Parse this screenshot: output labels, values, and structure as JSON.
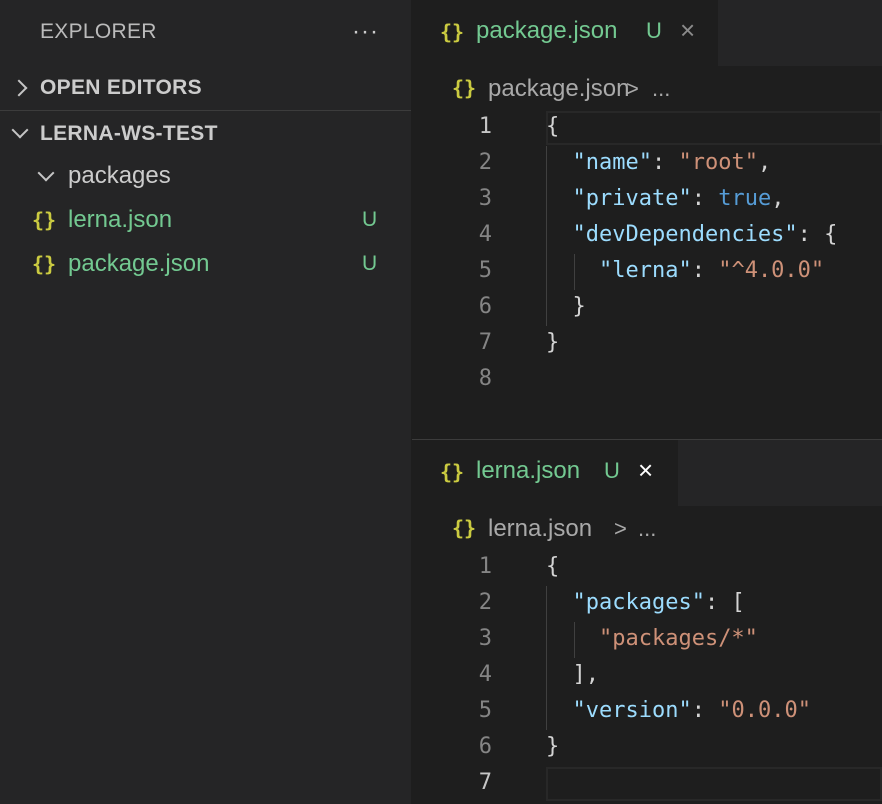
{
  "sidebar": {
    "title": "EXPLORER",
    "more_label": "···",
    "open_editors_label": "OPEN EDITORS",
    "workspace_label": "LERNA-WS-TEST",
    "tree": [
      {
        "name": "packages"
      },
      {
        "name": "lerna.json",
        "icon": "{}",
        "status": "U"
      },
      {
        "name": "package.json",
        "icon": "{}",
        "status": "U"
      }
    ]
  },
  "editor_top": {
    "tab": {
      "icon": "{}",
      "name": "package.json",
      "status": "U",
      "close": "×"
    },
    "breadcrumb": {
      "icon": "{}",
      "file": "package.json",
      "sep": ">",
      "more": "..."
    },
    "lines": [
      {
        "n": "1",
        "parts": [
          {
            "t": "{",
            "c": "p"
          }
        ]
      },
      {
        "n": "2",
        "parts": [
          {
            "t": "  ",
            "c": "p"
          },
          {
            "t": "\"name\"",
            "c": "k"
          },
          {
            "t": ": ",
            "c": "p"
          },
          {
            "t": "\"root\"",
            "c": "s"
          },
          {
            "t": ",",
            "c": "p"
          }
        ]
      },
      {
        "n": "3",
        "parts": [
          {
            "t": "  ",
            "c": "p"
          },
          {
            "t": "\"private\"",
            "c": "k"
          },
          {
            "t": ": ",
            "c": "p"
          },
          {
            "t": "true",
            "c": "b"
          },
          {
            "t": ",",
            "c": "p"
          }
        ]
      },
      {
        "n": "4",
        "parts": [
          {
            "t": "  ",
            "c": "p"
          },
          {
            "t": "\"devDependencies\"",
            "c": "k"
          },
          {
            "t": ": {",
            "c": "p"
          }
        ]
      },
      {
        "n": "5",
        "parts": [
          {
            "t": "    ",
            "c": "p"
          },
          {
            "t": "\"lerna\"",
            "c": "k"
          },
          {
            "t": ": ",
            "c": "p"
          },
          {
            "t": "\"^4.0.0\"",
            "c": "s"
          }
        ]
      },
      {
        "n": "6",
        "parts": [
          {
            "t": "  }",
            "c": "p"
          }
        ]
      },
      {
        "n": "7",
        "parts": [
          {
            "t": "}",
            "c": "p"
          }
        ]
      },
      {
        "n": "8",
        "parts": []
      }
    ]
  },
  "editor_bottom": {
    "tab": {
      "icon": "{}",
      "name": "lerna.json",
      "status": "U",
      "close": "×"
    },
    "breadcrumb": {
      "icon": "{}",
      "file": "lerna.json",
      "sep": ">",
      "more": "..."
    },
    "lines": [
      {
        "n": "1",
        "parts": [
          {
            "t": "{",
            "c": "p"
          }
        ]
      },
      {
        "n": "2",
        "parts": [
          {
            "t": "  ",
            "c": "p"
          },
          {
            "t": "\"packages\"",
            "c": "k"
          },
          {
            "t": ": [",
            "c": "p"
          }
        ]
      },
      {
        "n": "3",
        "parts": [
          {
            "t": "    ",
            "c": "p"
          },
          {
            "t": "\"packages/*\"",
            "c": "s"
          }
        ]
      },
      {
        "n": "4",
        "parts": [
          {
            "t": "  ],",
            "c": "p"
          }
        ]
      },
      {
        "n": "5",
        "parts": [
          {
            "t": "  ",
            "c": "p"
          },
          {
            "t": "\"version\"",
            "c": "k"
          },
          {
            "t": ": ",
            "c": "p"
          },
          {
            "t": "\"0.0.0\"",
            "c": "s"
          }
        ]
      },
      {
        "n": "6",
        "parts": [
          {
            "t": "}",
            "c": "p"
          }
        ]
      },
      {
        "n": "7",
        "parts": []
      }
    ]
  },
  "colors": {
    "untracked": "#73c991",
    "json_icon": "#cbcb41",
    "key": "#9cdcfe",
    "string": "#ce9178",
    "boolean": "#569cd6"
  }
}
